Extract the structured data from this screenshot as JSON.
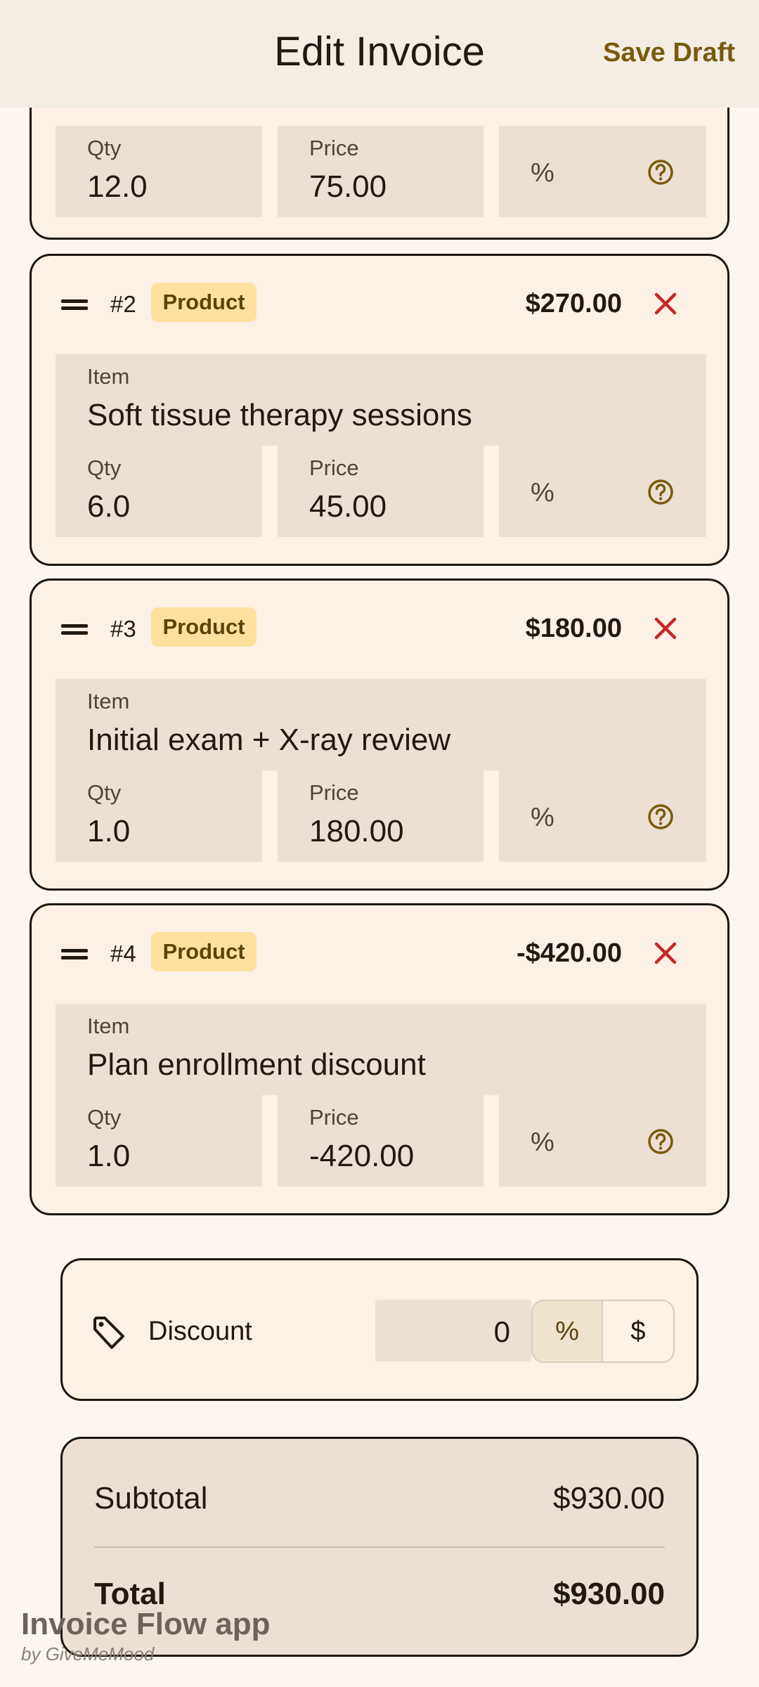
{
  "header": {
    "title": "Edit Invoice",
    "save_draft": "Save Draft"
  },
  "labels": {
    "item": "Item",
    "qty": "Qty",
    "price": "Price",
    "percent": "%"
  },
  "line_items": [
    {
      "qty": "12.0",
      "price": "75.00"
    },
    {
      "number": "#2",
      "badge": "Product",
      "amount": "$270.00",
      "item": "Soft tissue therapy sessions",
      "qty": "6.0",
      "price": "45.00"
    },
    {
      "number": "#3",
      "badge": "Product",
      "amount": "$180.00",
      "item": "Initial exam + X-ray review",
      "qty": "1.0",
      "price": "180.00"
    },
    {
      "number": "#4",
      "badge": "Product",
      "amount": "-$420.00",
      "item": "Plan enrollment discount",
      "qty": "1.0",
      "price": "-420.00"
    }
  ],
  "discount": {
    "label": "Discount",
    "value": "0",
    "options": [
      "%",
      "$"
    ],
    "selected": "%"
  },
  "totals": {
    "subtotal_label": "Subtotal",
    "subtotal": "$930.00",
    "total_label": "Total",
    "total": "$930.00"
  },
  "watermark": {
    "title": "Invoice Flow app",
    "subtitle": "by GiveMeMood"
  },
  "colors": {
    "accent": "#7a5a0c",
    "delete": "#c62828",
    "badge_bg": "#ffe09f",
    "field_bg": "#ece0d4",
    "card_bg": "#fdf1e5"
  }
}
